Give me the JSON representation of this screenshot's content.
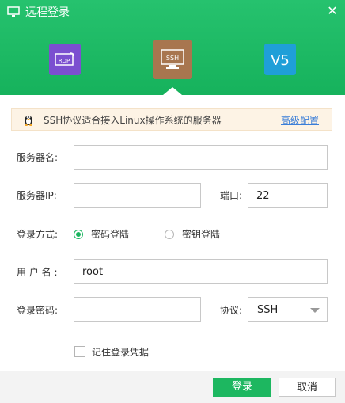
{
  "window": {
    "title": "远程登录",
    "close_glyph": "✕"
  },
  "protocols": [
    {
      "name": "rdp-icon",
      "label": "RDP",
      "color": "#7b4fd0"
    },
    {
      "name": "ssh-icon",
      "label": "SSH",
      "color": "#a8764f",
      "active": true
    },
    {
      "name": "vnc-icon",
      "label": "V5",
      "color": "#1f9fd8"
    }
  ],
  "notice": {
    "text": "SSH协议适合接入Linux操作系统的服务器",
    "link": "高级配置"
  },
  "form": {
    "server_name_label": "服务器名:",
    "server_name_value": "",
    "server_ip_label": "服务器IP:",
    "server_ip_value": "",
    "port_label": "端口:",
    "port_value": "22",
    "login_method_label": "登录方式:",
    "method_password": "密码登陆",
    "method_key": "密钥登陆",
    "username_label": "用 户 名 :",
    "username_value": "root",
    "password_label": "登录密码:",
    "password_value": "",
    "protocol_label": "协议:",
    "protocol_value": "SSH",
    "remember_label": "记住登录凭据"
  },
  "buttons": {
    "login": "登录",
    "cancel": "取消"
  },
  "colors": {
    "accent": "#1db760",
    "link": "#3b7ed8"
  }
}
